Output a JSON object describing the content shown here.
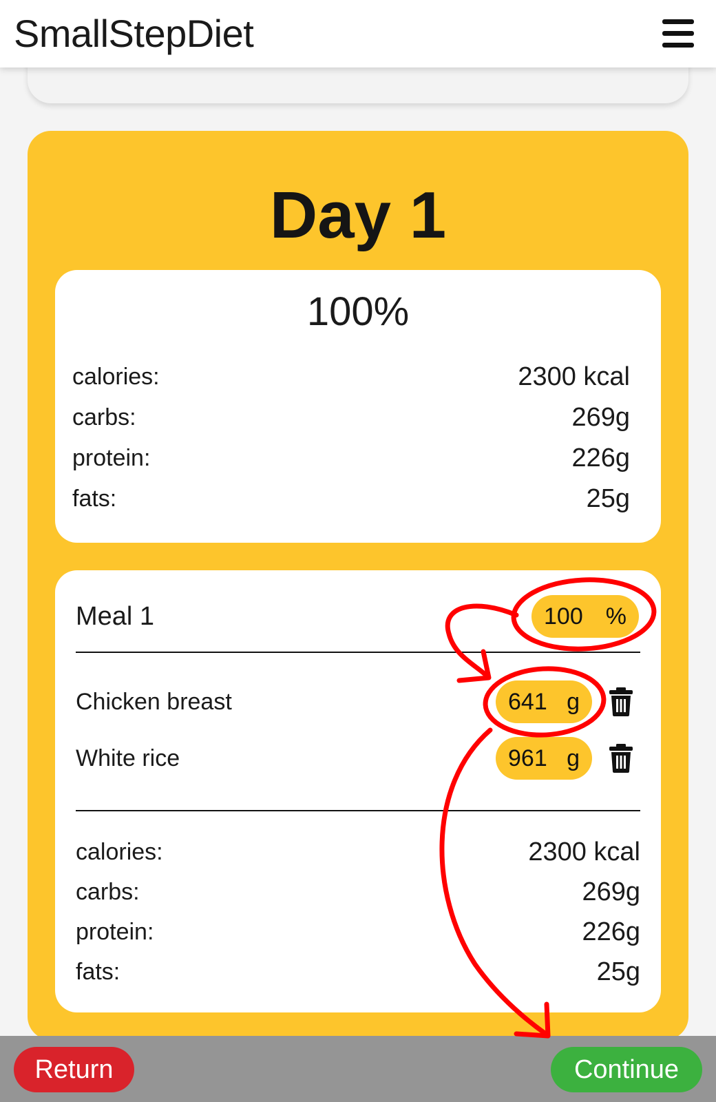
{
  "header": {
    "title": "SmallStepDiet"
  },
  "day": {
    "title": "Day 1",
    "summary": {
      "percent": "100%",
      "rows": [
        {
          "label": "calories:",
          "value": "2300 kcal"
        },
        {
          "label": "carbs:",
          "value": "269g"
        },
        {
          "label": "protein:",
          "value": "226g"
        },
        {
          "label": "fats:",
          "value": "25g"
        }
      ]
    }
  },
  "meal": {
    "title": "Meal 1",
    "percent_value": "100",
    "percent_unit": "%",
    "foods": [
      {
        "name": "Chicken breast",
        "amount": "641",
        "unit": "g"
      },
      {
        "name": "White rice",
        "amount": "961",
        "unit": "g"
      }
    ],
    "totals": [
      {
        "label": "calories:",
        "value": "2300 kcal"
      },
      {
        "label": "carbs:",
        "value": "269g"
      },
      {
        "label": "protein:",
        "value": "226g"
      },
      {
        "label": "fats:",
        "value": "25g"
      }
    ]
  },
  "footer": {
    "return_label": "Return",
    "continue_label": "Continue"
  },
  "colors": {
    "accent_yellow": "#fdc52c",
    "return_red": "#d9232b",
    "continue_green": "#3cb13f",
    "annotation_red": "#ff0000"
  },
  "icons": {
    "menu": "hamburger-menu-icon",
    "delete": "trash-icon"
  }
}
